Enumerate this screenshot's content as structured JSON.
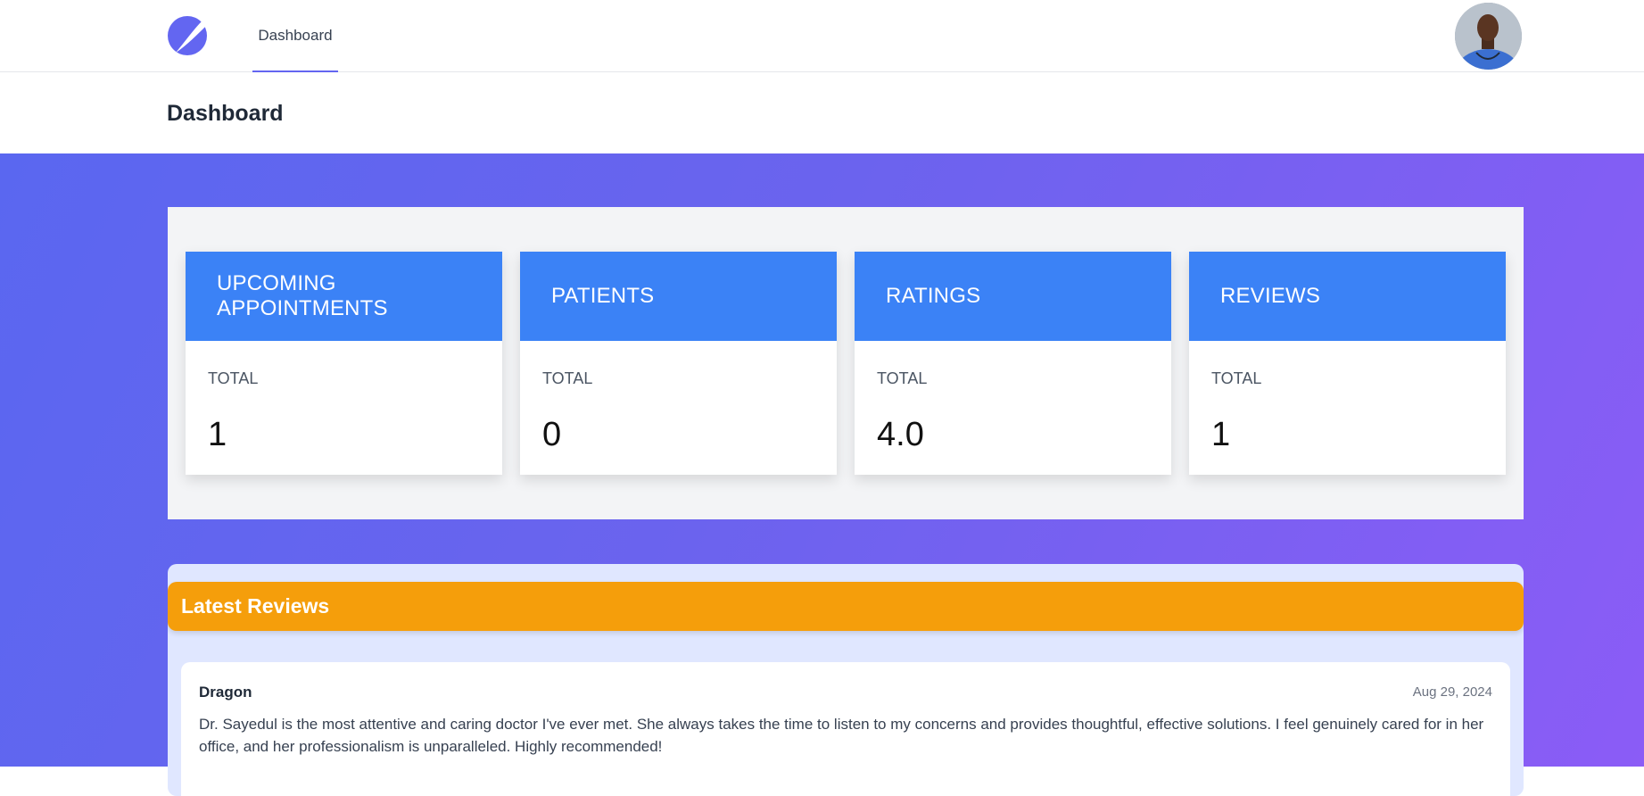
{
  "nav": {
    "logo_icon": "logo-icon",
    "tabs": [
      {
        "label": "Dashboard",
        "active": true
      }
    ],
    "avatar_icon": "user-avatar",
    "accent": "#6366f1"
  },
  "page": {
    "title": "Dashboard"
  },
  "stats": [
    {
      "title": "UPCOMING APPOINTMENTS",
      "label": "TOTAL",
      "value": "1"
    },
    {
      "title": "PATIENTS",
      "label": "TOTAL",
      "value": "0"
    },
    {
      "title": "RATINGS",
      "label": "TOTAL",
      "value": "4.0"
    },
    {
      "title": "REVIEWS",
      "label": "TOTAL",
      "value": "1"
    }
  ],
  "reviews": {
    "heading": "Latest Reviews",
    "items": [
      {
        "author": "Dragon",
        "date": "Aug 29, 2024",
        "text": "Dr. Sayedul is the most attentive and caring doctor I've ever met. She always takes the time to listen to my concerns and provides thoughtful, effective solutions. I feel genuinely cared for in her office, and her professionalism is unparalleled. Highly recommended!"
      }
    ]
  },
  "colors": {
    "stat_header": "#3b82f6",
    "reviews_header": "#f59e0b",
    "gradient_start": "#5a67f0",
    "gradient_end": "#8b5cf6"
  }
}
